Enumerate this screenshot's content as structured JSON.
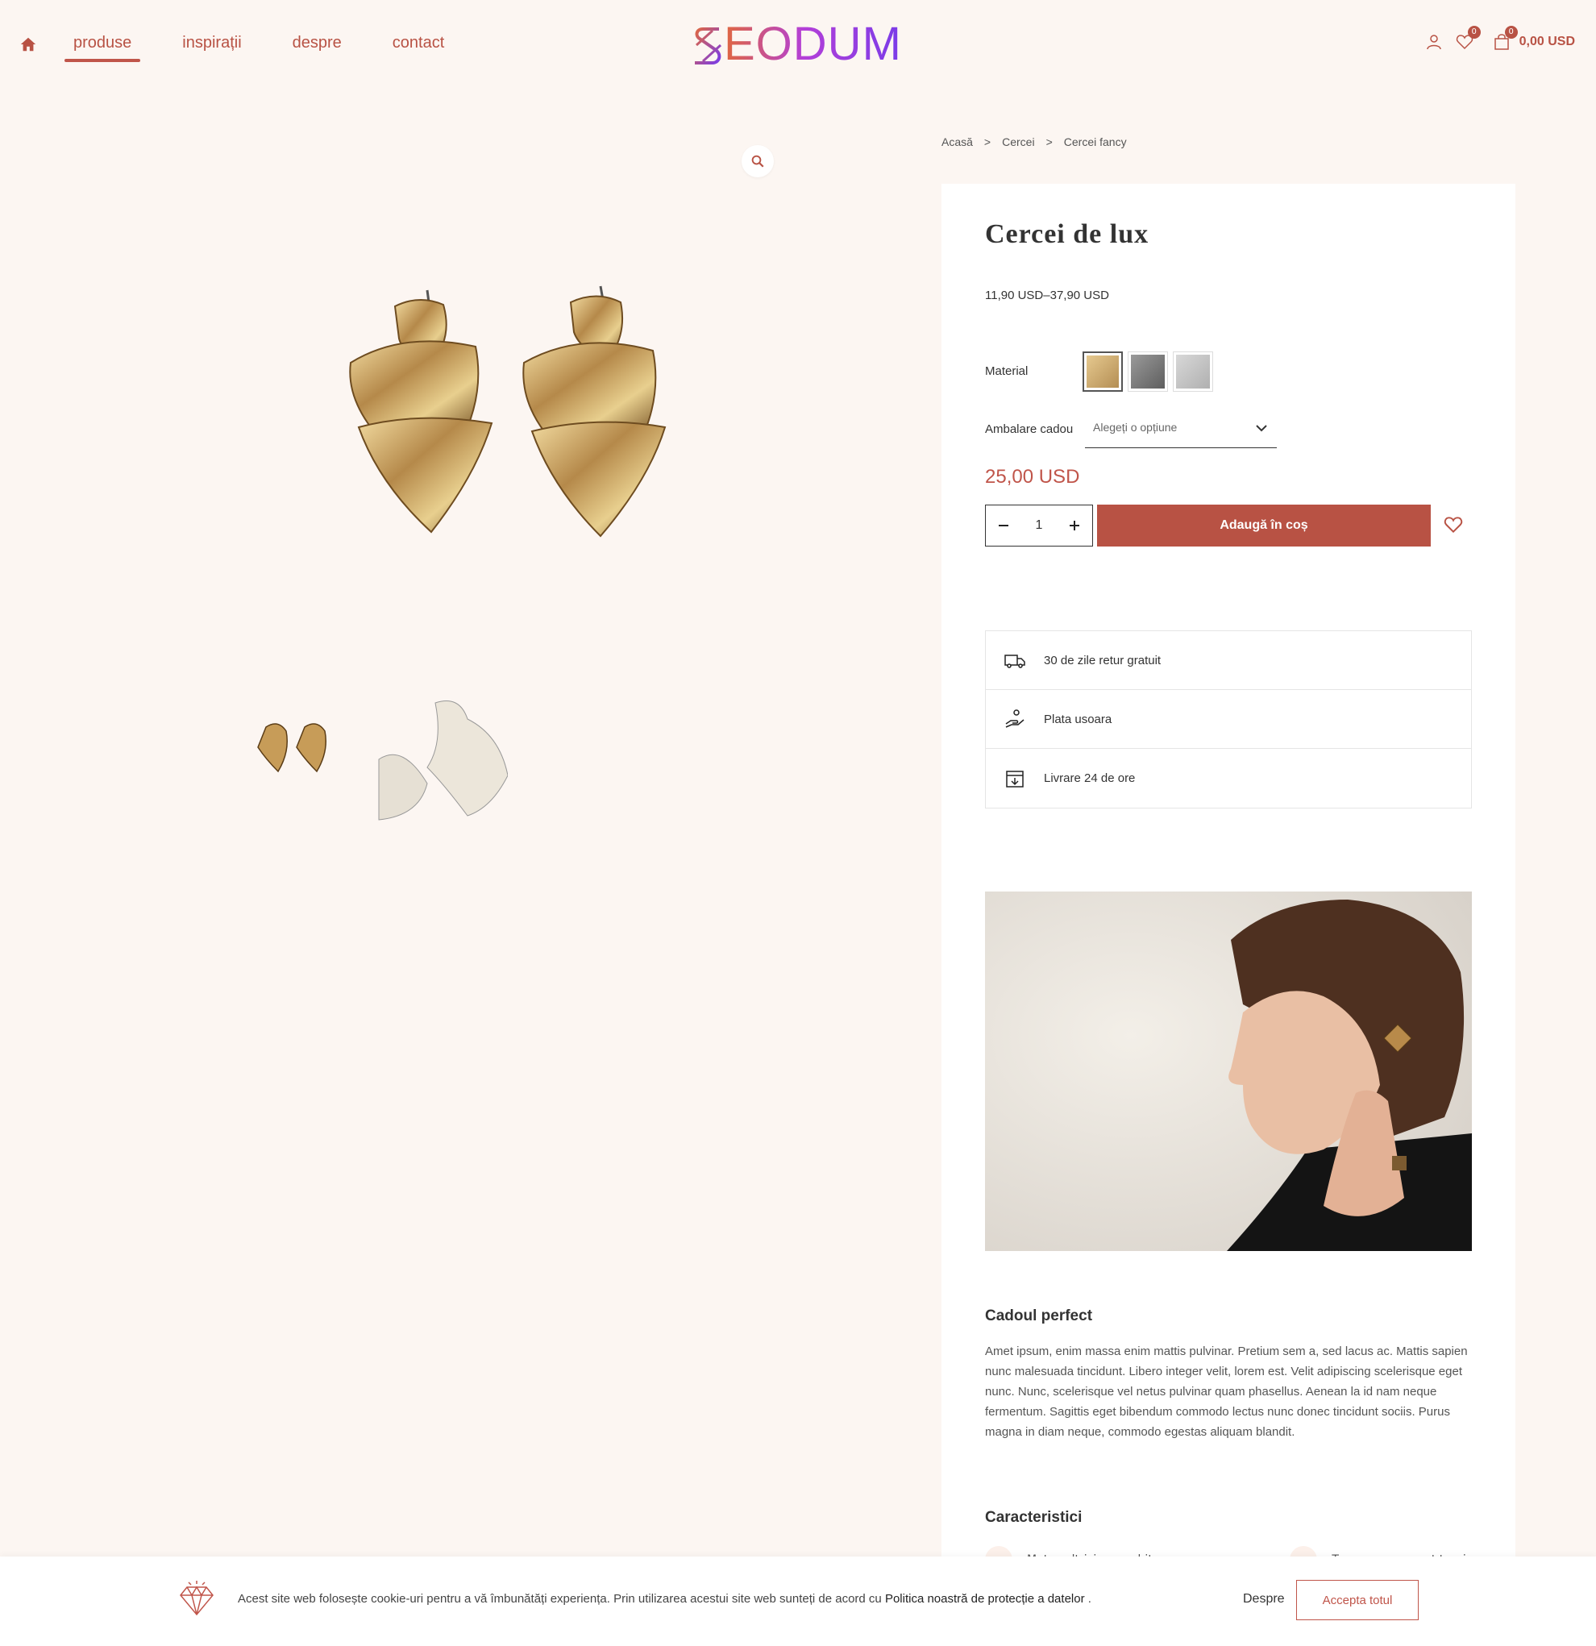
{
  "header": {
    "nav": [
      {
        "label": "produse",
        "active": true
      },
      {
        "label": "inspirații",
        "active": false
      },
      {
        "label": "despre",
        "active": false
      },
      {
        "label": "contact",
        "active": false
      }
    ],
    "logo_text": "EODUM",
    "wishlist_count": "0",
    "cart_count": "0",
    "cart_total": "0,00 USD"
  },
  "breadcrumb": [
    "Acasă",
    "Cercei",
    "Cercei fancy"
  ],
  "breadcrumb_sep": ">",
  "product": {
    "title": "Cercei de lux",
    "price_range": "11,90 USD–37,90 USD",
    "material_label": "Material",
    "materials": [
      "gold",
      "dark-silver",
      "silver"
    ],
    "wrap_label": "Ambalare cadou",
    "wrap_placeholder": "Alegeți o opțiune",
    "price": "25,00 USD",
    "quantity": "1",
    "add_to_cart": "Adaugă în coș"
  },
  "features": [
    {
      "icon": "truck-icon",
      "label": "30 de zile retur gratuit"
    },
    {
      "icon": "payment-hand-icon",
      "label": "Plata usoara"
    },
    {
      "icon": "box-download-icon",
      "label": "Livrare 24 de ore"
    }
  ],
  "description": {
    "title": "Cadoul perfect",
    "text": "Amet ipsum, enim massa enim mattis pulvinar. Pretium sem a, sed lacus ac. Mattis sapien nunc malesuada tincidunt. Libero integer velit, lorem est. Velit adipiscing scelerisque eget nunc. Nunc, scelerisque vel netus pulvinar quam phasellus. Aenean la id nam neque fermentum. Sagittis eget bibendum commodo lectus nunc donec tincidunt sociis. Purus magna in diam neque, commodo egestas aliquam blandit."
  },
  "characteristics": {
    "title": "Caracteristici",
    "items": [
      "Metus ultricies curabitur",
      "Tempor consequat turpis"
    ]
  },
  "cookie": {
    "text": "Acest site web folosește cookie-uri pentru a vă îmbunătăți experiența. Prin utilizarea acestui site web sunteți de acord cu ",
    "link": "Politica noastră de protecție a datelor",
    "after": " .",
    "about": "Despre",
    "accept": "Accepta totul"
  },
  "colors": {
    "accent": "#b85244",
    "background": "#fcf6f2"
  }
}
